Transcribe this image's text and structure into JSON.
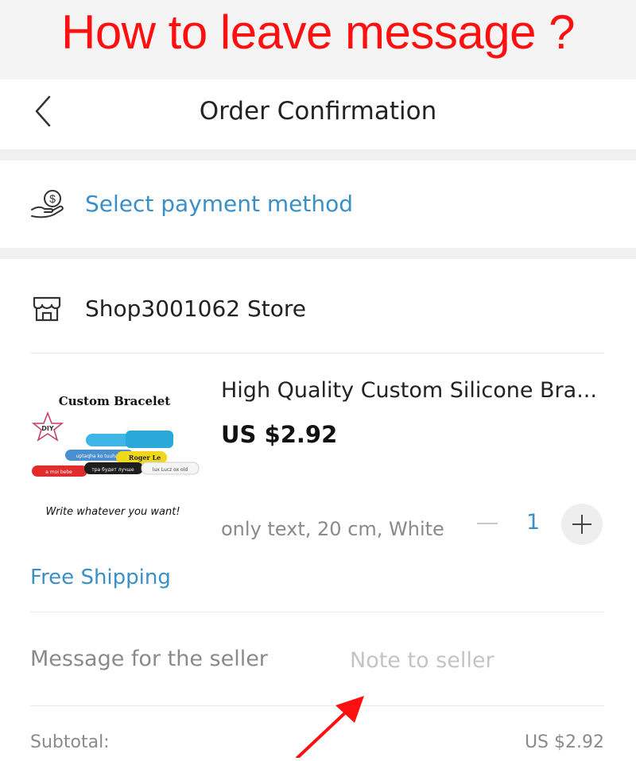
{
  "banner": {
    "title": "How to leave message ?"
  },
  "header": {
    "title": "Order Confirmation"
  },
  "payment": {
    "label": "Select payment method",
    "icon": "hand-dollar-icon"
  },
  "store": {
    "name": "Shop3001062 Store",
    "icon": "store-icon"
  },
  "product": {
    "title": "High Quality Custom Silicone Bra...",
    "price": "US $2.92",
    "spec": "only text, 20 cm, White",
    "quantity": "1",
    "image": {
      "heading": "Custom Bracelet",
      "star_text": "DIY",
      "caption": "Write whatever you want!",
      "band_texts": [
        "Roger Le",
        "uptaqha ko tuuhaa",
        "a moi bebe",
        "тра будет лучше",
        "lux Lucz ox old"
      ]
    }
  },
  "shipping": {
    "label": "Free Shipping"
  },
  "message": {
    "label": "Message for the seller",
    "placeholder": "Note to seller"
  },
  "summary": {
    "subtotal_label": "Subtotal:",
    "subtotal_value": "US $2.92"
  },
  "colors": {
    "accent": "#3a8fc7",
    "banner_text": "#ff1010",
    "arrow": "#ff1010"
  }
}
